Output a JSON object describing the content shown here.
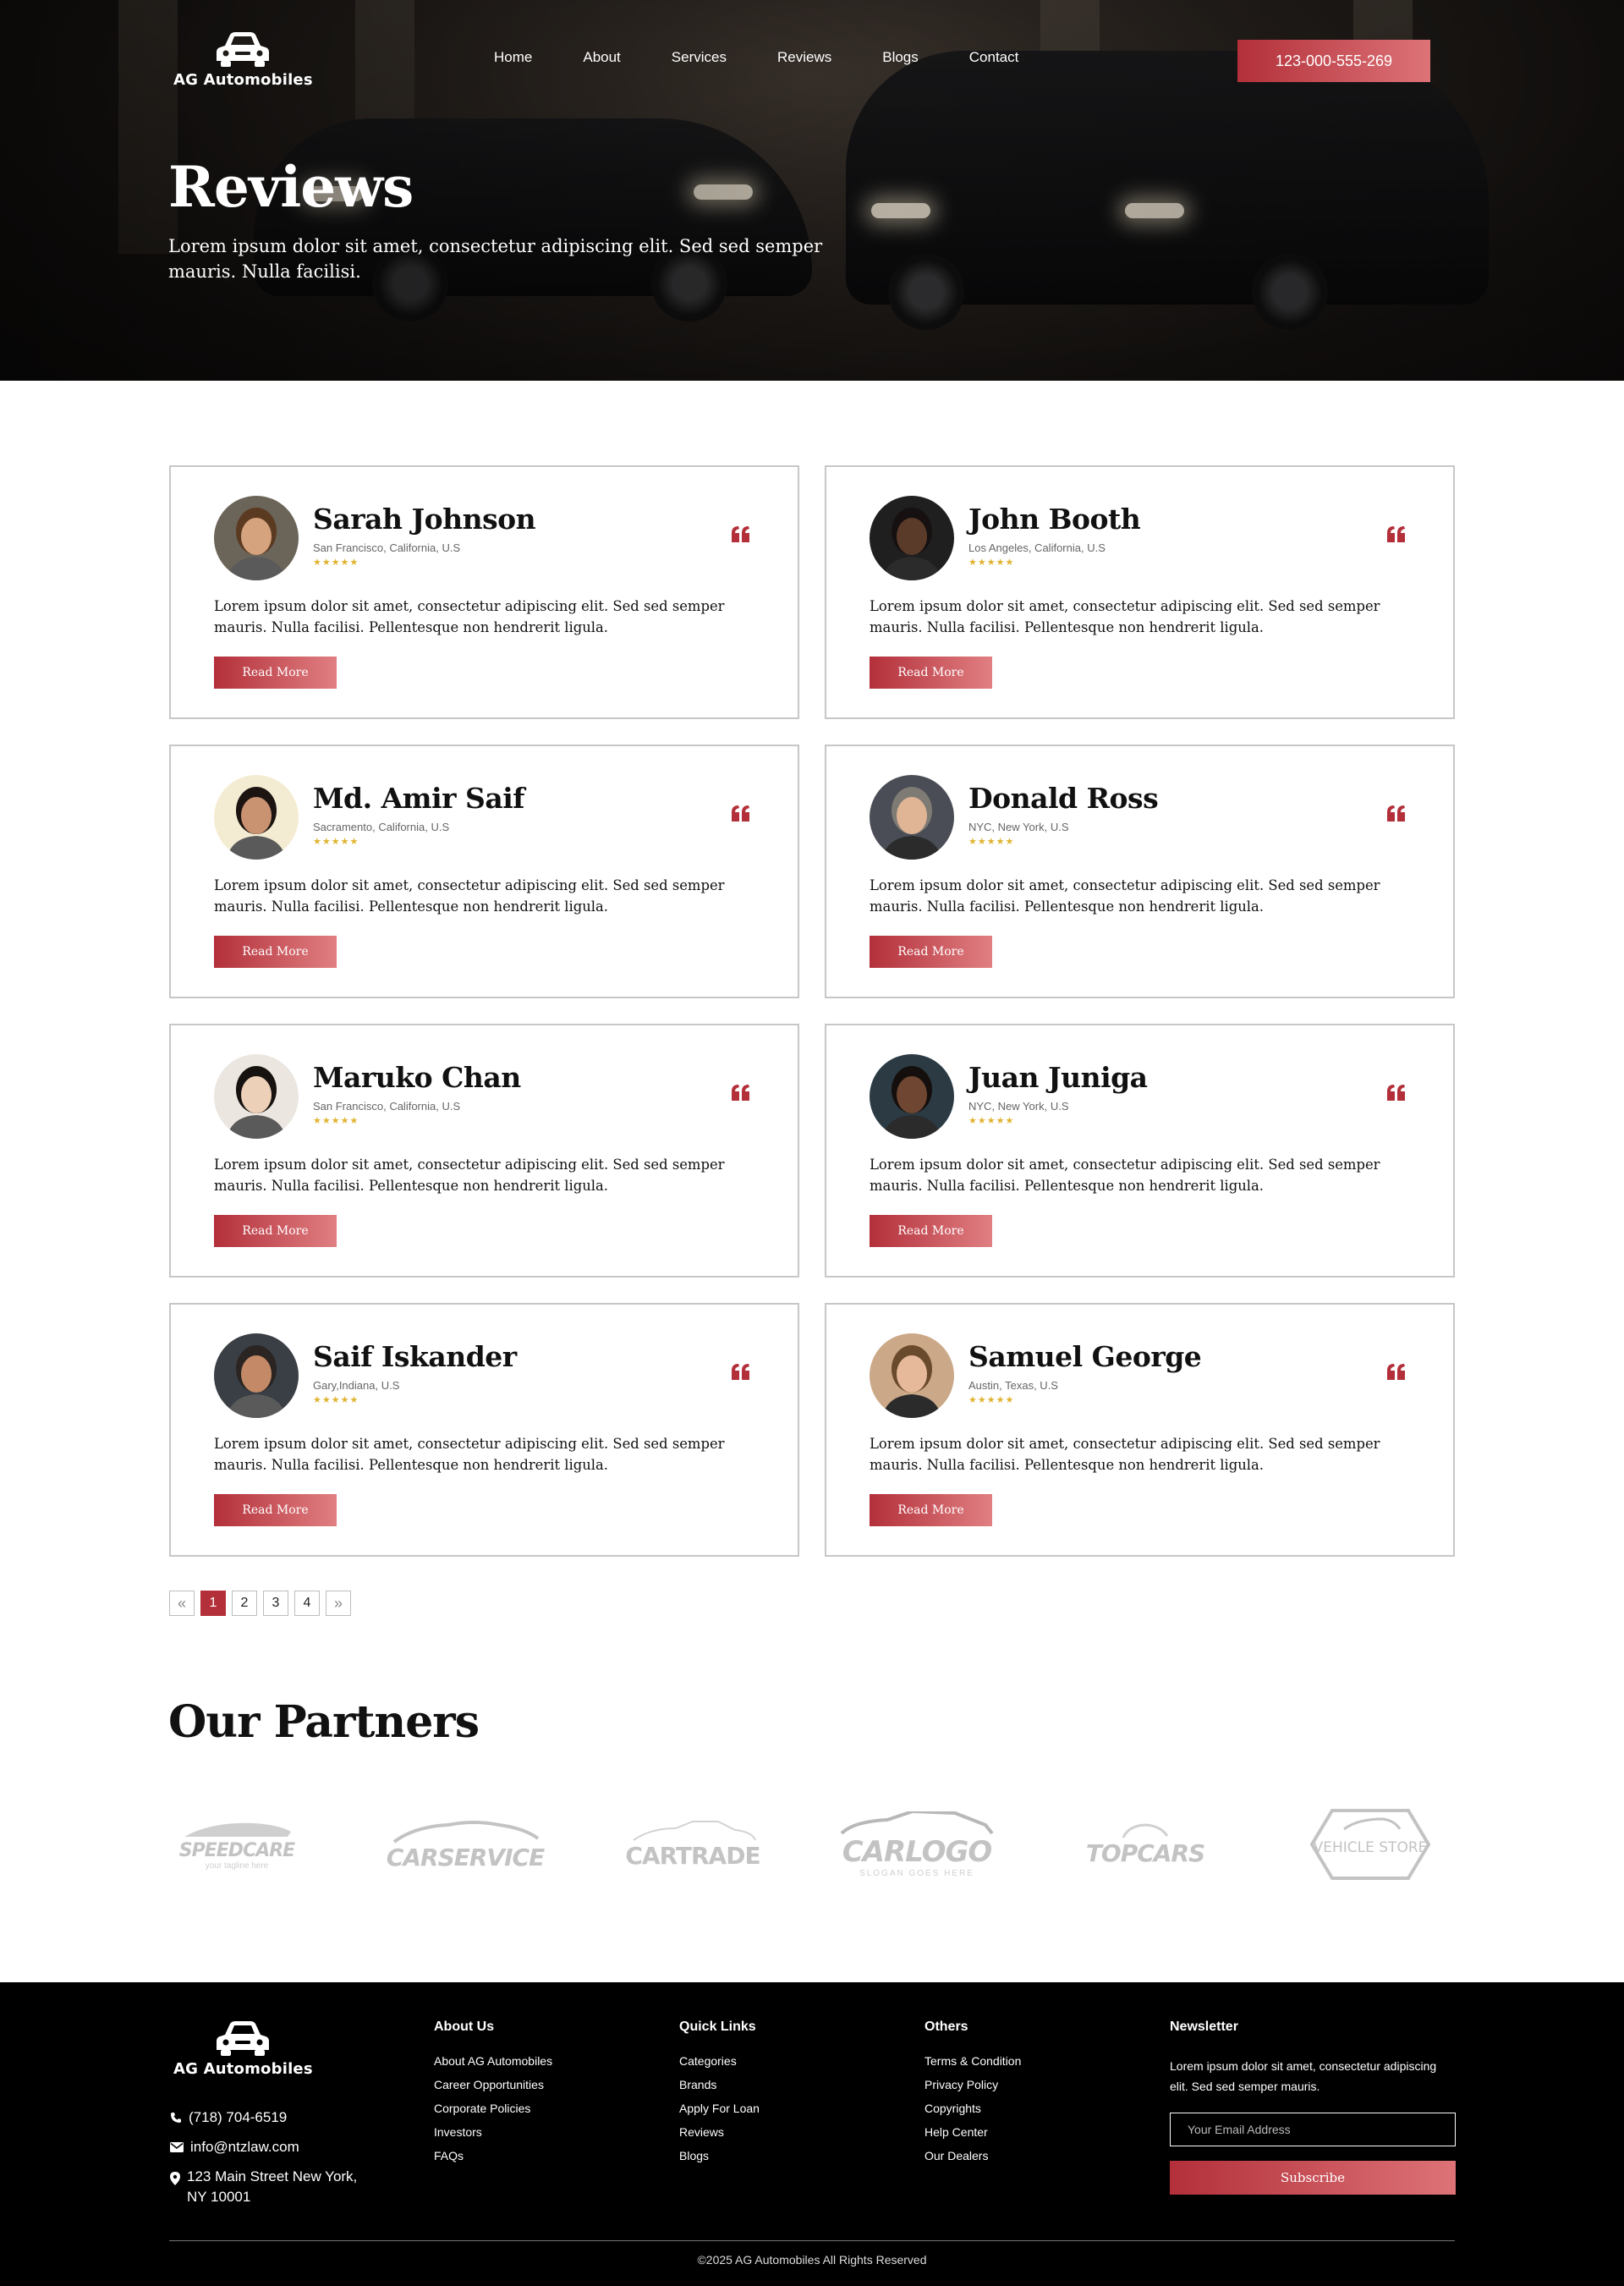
{
  "brand": {
    "name": "AG Automobiles"
  },
  "nav": {
    "items": [
      "Home",
      "About",
      "Services",
      "Reviews",
      "Blogs",
      "Contact"
    ],
    "phone": "123-000-555-269"
  },
  "hero": {
    "title": "Reviews",
    "subtitle": "Lorem ipsum dolor sit amet, consectetur adipiscing elit. Sed sed semper mauris. Nulla facilisi."
  },
  "reviews": [
    {
      "name": "Sarah Johnson",
      "location": "San Francisco, California, U.S",
      "stars": "★★★★★",
      "text": "Lorem ipsum dolor sit amet, consectetur adipiscing elit. Sed sed semper mauris. Nulla facilisi. Pellentesque non hendrerit ligula.",
      "button": "Read More",
      "avatar": "woman-portrait"
    },
    {
      "name": "John Booth",
      "location": "Los Angeles, California, U.S",
      "stars": "★★★★★",
      "text": "Lorem ipsum dolor sit amet, consectetur adipiscing elit. Sed sed semper mauris. Nulla facilisi. Pellentesque non hendrerit ligula.",
      "button": "Read More",
      "avatar": "man-portrait"
    },
    {
      "name": "Md. Amir Saif",
      "location": "Sacramento, California, U.S",
      "stars": "★★★★★",
      "text": "Lorem ipsum dolor sit amet, consectetur adipiscing elit. Sed sed semper mauris. Nulla facilisi. Pellentesque non hendrerit ligula.",
      "button": "Read More",
      "avatar": "man-portrait"
    },
    {
      "name": "Donald Ross",
      "location": "NYC, New York, U.S",
      "stars": "★★★★★",
      "text": "Lorem ipsum dolor sit amet, consectetur adipiscing elit. Sed sed semper mauris. Nulla facilisi. Pellentesque non hendrerit ligula.",
      "button": "Read More",
      "avatar": "man-portrait"
    },
    {
      "name": "Maruko Chan",
      "location": "San Francisco, California, U.S",
      "stars": "★★★★★",
      "text": "Lorem ipsum dolor sit amet, consectetur adipiscing elit. Sed sed semper mauris. Nulla facilisi. Pellentesque non hendrerit ligula.",
      "button": "Read More",
      "avatar": "woman-portrait"
    },
    {
      "name": "Juan Juniga",
      "location": "NYC, New York, U.S",
      "stars": "★★★★★",
      "text": "Lorem ipsum dolor sit amet, consectetur adipiscing elit. Sed sed semper mauris. Nulla facilisi. Pellentesque non hendrerit ligula.",
      "button": "Read More",
      "avatar": "man-portrait"
    },
    {
      "name": "Saif Iskander",
      "location": "Gary,Indiana, U.S",
      "stars": "★★★★★",
      "text": "Lorem ipsum dolor sit amet, consectetur adipiscing elit. Sed sed semper mauris. Nulla facilisi. Pellentesque non hendrerit ligula.",
      "button": "Read More",
      "avatar": "man-portrait"
    },
    {
      "name": "Samuel George",
      "location": "Austin, Texas, U.S",
      "stars": "★★★★★",
      "text": "Lorem ipsum dolor sit amet, consectetur adipiscing elit. Sed sed semper mauris. Nulla facilisi. Pellentesque non hendrerit ligula.",
      "button": "Read More",
      "avatar": "man-portrait"
    }
  ],
  "pagination": {
    "prev": "«",
    "pages": [
      "1",
      "2",
      "3",
      "4"
    ],
    "current": "1",
    "next": "»"
  },
  "partners": {
    "title": "Our Partners",
    "logos": [
      {
        "name": "SPEEDCARE",
        "tag": "your tagline here"
      },
      {
        "name": "CARSERVICE",
        "tag": ""
      },
      {
        "name": "CARTRADE",
        "tag": ""
      },
      {
        "name": "CARLOGO",
        "tag": "SLOGAN GOES HERE"
      },
      {
        "name": "TOPCARS",
        "tag": ""
      },
      {
        "name": "VEHICLE STORE",
        "tag": ""
      }
    ]
  },
  "footer": {
    "contact": {
      "phone": "(718) 704-6519",
      "email": "info@ntzlaw.com",
      "address_line1": "123 Main Street  New York,",
      "address_line2": "NY 10001"
    },
    "about": {
      "heading": "About Us",
      "links": [
        "About AG Automobiles",
        "Career Opportunities",
        "Corporate Policies",
        "Investors",
        "FAQs"
      ]
    },
    "quick": {
      "heading": "Quick Links",
      "links": [
        "Categories",
        "Brands",
        "Apply For Loan",
        "Reviews",
        "Blogs"
      ]
    },
    "others": {
      "heading": "Others",
      "links": [
        "Terms & Condition",
        "Privacy Policy",
        "Copyrights",
        "Help Center",
        "Our Dealers"
      ]
    },
    "newsletter": {
      "heading": "Newsletter",
      "text": "Lorem ipsum dolor sit amet, consectetur adipiscing elit. Sed sed semper mauris.",
      "placeholder": "Your Email Address",
      "button": "Subscribe"
    },
    "copyright": "©2025   AG Automobiles  All Rights Reserved"
  },
  "colors": {
    "accent": "#b3303a",
    "accent_light": "#dd7377",
    "star": "#e0b32f",
    "footer_bg": "#000000"
  }
}
